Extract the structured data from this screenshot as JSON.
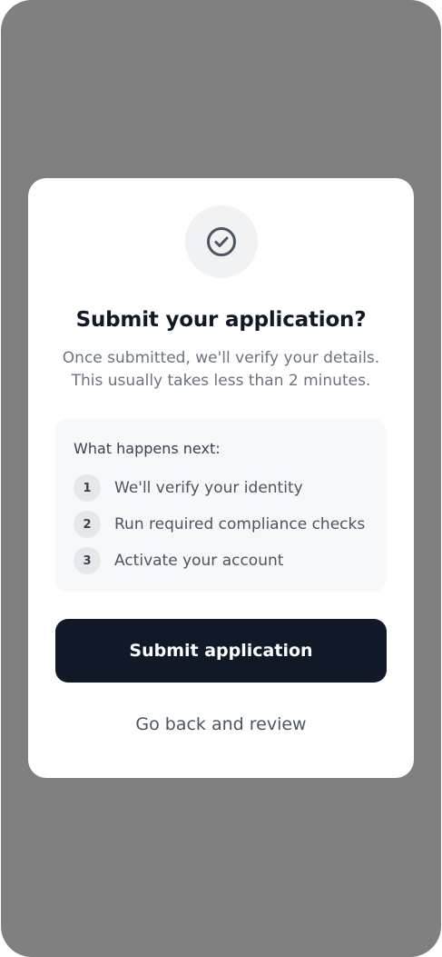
{
  "dialog": {
    "icon": "check-circle-icon",
    "title": "Submit your application?",
    "subtitle": "Once submitted, we'll verify your details. This usually takes less than 2 minutes."
  },
  "next_steps": {
    "heading": "What happens next:",
    "items": [
      {
        "number": "1",
        "label": "We'll verify your identity"
      },
      {
        "number": "2",
        "label": "Run required compliance checks"
      },
      {
        "number": "3",
        "label": "Activate your account"
      }
    ]
  },
  "actions": {
    "submit_label": "Submit application",
    "back_label": "Go back and review"
  },
  "colors": {
    "backdrop": "#808080",
    "card": "#ffffff",
    "primary_button": "#111827",
    "text_primary": "#111827",
    "text_muted": "#6b7280",
    "steps_box": "#f7f8fa"
  }
}
